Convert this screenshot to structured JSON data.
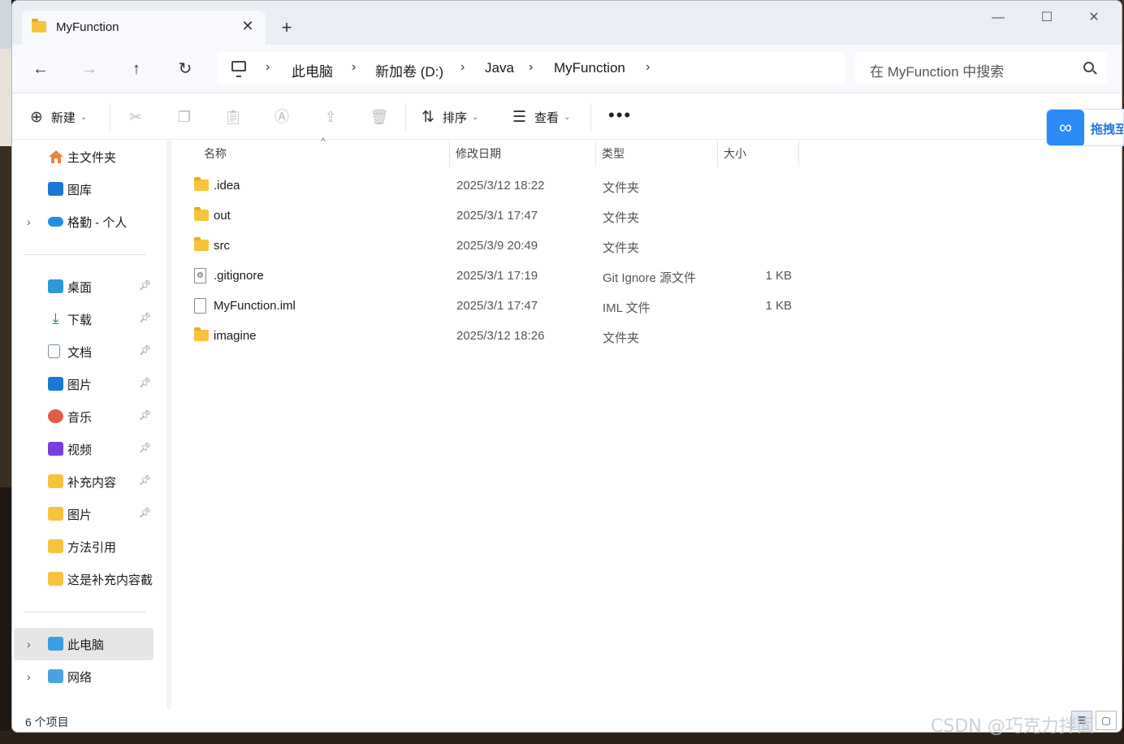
{
  "tab": {
    "title": "MyFunction",
    "close": "✕",
    "new_tab": "+"
  },
  "window_controls": {
    "minimize": "—",
    "maximize": "☐",
    "close": "✕"
  },
  "nav": {
    "back": "←",
    "forward": "→",
    "up": "↑",
    "refresh": "↻"
  },
  "breadcrumb": {
    "items": [
      "此电脑",
      "新加卷 (D:)",
      "Java",
      "MyFunction"
    ],
    "separator": "›"
  },
  "search": {
    "placeholder": "在 MyFunction 中搜索"
  },
  "commands": {
    "new_label": "新建",
    "sort_label": "排序",
    "view_label": "查看",
    "more": "•••",
    "dropdown": "⌄"
  },
  "baidu": {
    "label": "拖拽至"
  },
  "sidebar": {
    "quick": [
      {
        "label": "主文件夹",
        "icon": "home-icon"
      },
      {
        "label": "图库",
        "icon": "gallery-icon"
      },
      {
        "label": "格勤 - 个人",
        "icon": "onedrive-icon"
      }
    ],
    "pinned": [
      {
        "label": "桌面",
        "icon": "desktop-icon",
        "pinned": true
      },
      {
        "label": "下载",
        "icon": "download-icon",
        "pinned": true
      },
      {
        "label": "文档",
        "icon": "document-icon",
        "pinned": true
      },
      {
        "label": "图片",
        "icon": "pictures-icon",
        "pinned": true
      },
      {
        "label": "音乐",
        "icon": "music-icon",
        "pinned": true
      },
      {
        "label": "视频",
        "icon": "video-icon",
        "pinned": true
      },
      {
        "label": "补充内容",
        "icon": "folder-icon",
        "pinned": true
      },
      {
        "label": "图片",
        "icon": "folder-icon",
        "pinned": true
      },
      {
        "label": "方法引用",
        "icon": "folder-icon",
        "pinned": false
      },
      {
        "label": "这是补充内容截",
        "icon": "folder-icon",
        "pinned": false
      }
    ],
    "devices": [
      {
        "label": "此电脑",
        "icon": "pc-icon",
        "selected": true
      },
      {
        "label": "网络",
        "icon": "network-icon",
        "selected": false
      }
    ]
  },
  "columns": {
    "name": "名称",
    "date": "修改日期",
    "type": "类型",
    "size": "大小"
  },
  "files": [
    {
      "name": ".idea",
      "date": "2025/3/12 18:22",
      "type": "文件夹",
      "size": "",
      "kind": "folder"
    },
    {
      "name": "out",
      "date": "2025/3/1 17:47",
      "type": "文件夹",
      "size": "",
      "kind": "folder"
    },
    {
      "name": "src",
      "date": "2025/3/9 20:49",
      "type": "文件夹",
      "size": "",
      "kind": "folder"
    },
    {
      "name": ".gitignore",
      "date": "2025/3/1 17:19",
      "type": "Git Ignore 源文件",
      "size": "1 KB",
      "kind": "config"
    },
    {
      "name": "MyFunction.iml",
      "date": "2025/3/1 17:47",
      "type": "IML 文件",
      "size": "1 KB",
      "kind": "file"
    },
    {
      "name": "imagine",
      "date": "2025/3/12 18:26",
      "type": "文件夹",
      "size": "",
      "kind": "folder"
    }
  ],
  "status": {
    "count": "6 个项目"
  },
  "watermark": "CSDN @巧克力拌面"
}
